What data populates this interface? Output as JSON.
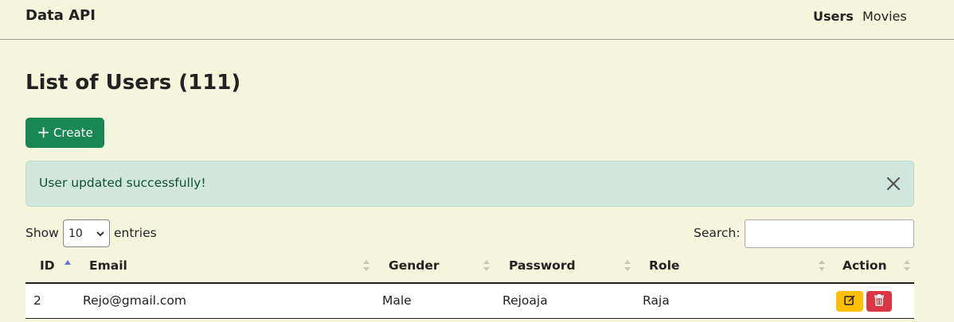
{
  "navbar": {
    "brand": "Data API",
    "links": [
      {
        "label": "Users",
        "active": true
      },
      {
        "label": "Movies",
        "active": false
      }
    ]
  },
  "page": {
    "title": "List of Users (111)",
    "create_label": "Create"
  },
  "alert": {
    "message": "User updated successfully!"
  },
  "controls": {
    "show_label": "Show",
    "entries_value": "10",
    "entries_label": "entries",
    "search_label": "Search:",
    "search_value": ""
  },
  "table": {
    "columns": [
      "ID",
      "Email",
      "Gender",
      "Password",
      "Role",
      "Action"
    ],
    "sorted_column": "ID",
    "rows": [
      {
        "id": "2",
        "email": "Rejo@gmail.com",
        "gender": "Male",
        "password": "Rejoaja",
        "role": "Raja"
      }
    ]
  },
  "icons": {
    "create": "plus-icon",
    "close": "close-icon",
    "edit": "edit-icon",
    "delete": "trash-icon"
  },
  "colors": {
    "background": "#f5f4dc",
    "success": "#198754",
    "alert_bg": "#d1e7dd",
    "warning": "#ffc107",
    "danger": "#dc3545"
  }
}
